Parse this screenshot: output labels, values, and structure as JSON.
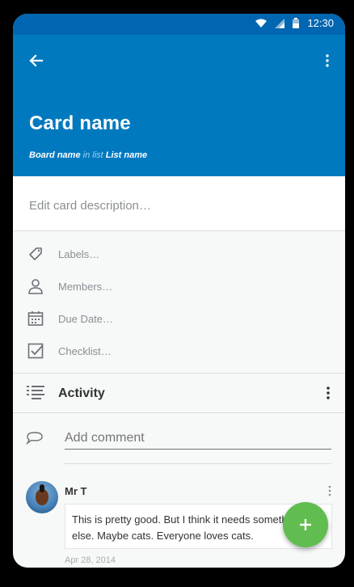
{
  "statusbar": {
    "time": "12:30"
  },
  "header": {
    "title": "Card name",
    "subtitle": {
      "board": "Board name",
      "in_list": "in list",
      "list": "List name"
    }
  },
  "description": {
    "placeholder": "Edit card description…"
  },
  "fields": [
    {
      "icon": "label-icon",
      "label": "Labels…"
    },
    {
      "icon": "person-icon",
      "label": "Members…"
    },
    {
      "icon": "calendar-icon",
      "label": "Due Date…"
    },
    {
      "icon": "checkbox-icon",
      "label": "Checklist…"
    }
  ],
  "activity": {
    "label": "Activity"
  },
  "comment": {
    "placeholder": "Add comment"
  },
  "feed": [
    {
      "author": "Mr T",
      "text": "This is pretty good. But I think it needs something else. Maybe cats. Everyone loves cats.",
      "date": "Apr 28, 2014"
    }
  ],
  "colors": {
    "header": "#0079bf",
    "statusbar": "#0066b1",
    "fab": "#61bd4f"
  }
}
